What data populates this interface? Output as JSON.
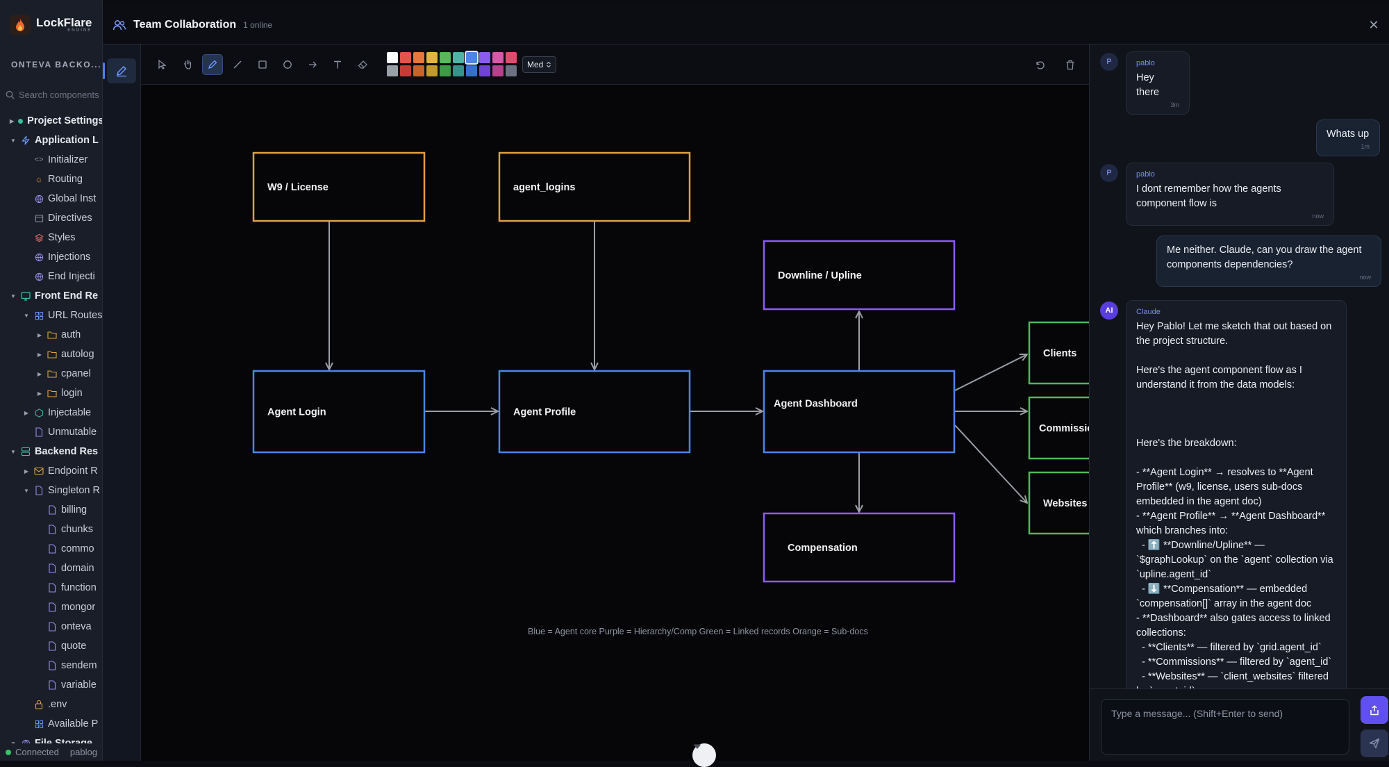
{
  "sidebar": {
    "brand_name": "LockFlare",
    "brand_sub": "ENGINE",
    "project_name": "ONTEVA BACKO...",
    "search_placeholder": "Search components",
    "tree": [
      {
        "label": "Project Settings",
        "arrow": "right",
        "icon": "green-dot-icon",
        "bold": true,
        "indent": 0
      },
      {
        "label": "Application L",
        "arrow": "down",
        "icon": "lightning-icon",
        "bold": true,
        "indent": 0
      },
      {
        "label": "Initializer",
        "arrow": "",
        "icon": "code-icon",
        "bold": false,
        "indent": 1
      },
      {
        "label": "Routing",
        "arrow": "",
        "icon": "sun-icon",
        "bold": false,
        "indent": 1
      },
      {
        "label": "Global Inst",
        "arrow": "",
        "icon": "globe-icon",
        "bold": false,
        "indent": 1
      },
      {
        "label": "Directives",
        "arrow": "",
        "icon": "window-icon",
        "bold": false,
        "indent": 1
      },
      {
        "label": "Styles",
        "arrow": "",
        "icon": "layers-icon",
        "bold": false,
        "indent": 1
      },
      {
        "label": "Injections",
        "arrow": "",
        "icon": "globe-icon",
        "bold": false,
        "indent": 1
      },
      {
        "label": "End Injecti",
        "arrow": "",
        "icon": "globe-icon",
        "bold": false,
        "indent": 1
      },
      {
        "label": "Front End Re",
        "arrow": "down",
        "icon": "monitor-icon",
        "bold": true,
        "indent": 0
      },
      {
        "label": "URL Routes",
        "arrow": "down",
        "icon": "grid-icon",
        "bold": false,
        "indent": 1
      },
      {
        "label": "auth",
        "arrow": "right",
        "icon": "folder-icon",
        "bold": false,
        "indent": 2
      },
      {
        "label": "autolog",
        "arrow": "right",
        "icon": "folder-icon",
        "bold": false,
        "indent": 2
      },
      {
        "label": "cpanel",
        "arrow": "right",
        "icon": "folder-icon",
        "bold": false,
        "indent": 2
      },
      {
        "label": "login",
        "arrow": "right",
        "icon": "folder-icon",
        "bold": false,
        "indent": 2
      },
      {
        "label": "Injectable",
        "arrow": "right",
        "icon": "hexagon-icon",
        "bold": false,
        "indent": 1
      },
      {
        "label": "Unmutable",
        "arrow": "",
        "icon": "file-icon",
        "bold": false,
        "indent": 1
      },
      {
        "label": "Backend Res",
        "arrow": "down",
        "icon": "database-icon",
        "bold": true,
        "indent": 0
      },
      {
        "label": "Endpoint R",
        "arrow": "right",
        "icon": "mail-icon",
        "bold": false,
        "indent": 1
      },
      {
        "label": "Singleton R",
        "arrow": "down",
        "icon": "file-icon",
        "bold": false,
        "indent": 1
      },
      {
        "label": "billing",
        "arrow": "",
        "icon": "file-icon",
        "bold": false,
        "indent": 2
      },
      {
        "label": "chunks",
        "arrow": "",
        "icon": "file-icon",
        "bold": false,
        "indent": 2
      },
      {
        "label": "commo",
        "arrow": "",
        "icon": "file-icon",
        "bold": false,
        "indent": 2
      },
      {
        "label": "domain",
        "arrow": "",
        "icon": "file-icon",
        "bold": false,
        "indent": 2
      },
      {
        "label": "function",
        "arrow": "",
        "icon": "file-icon",
        "bold": false,
        "indent": 2
      },
      {
        "label": "mongor",
        "arrow": "",
        "icon": "file-icon",
        "bold": false,
        "indent": 2
      },
      {
        "label": "onteva",
        "arrow": "",
        "icon": "file-icon",
        "bold": false,
        "indent": 2
      },
      {
        "label": "quote",
        "arrow": "",
        "icon": "file-icon",
        "bold": false,
        "indent": 2
      },
      {
        "label": "sendem",
        "arrow": "",
        "icon": "file-icon",
        "bold": false,
        "indent": 2
      },
      {
        "label": "variable",
        "arrow": "",
        "icon": "file-icon",
        "bold": false,
        "indent": 2
      },
      {
        "label": ".env",
        "arrow": "",
        "icon": "lock-icon",
        "bold": false,
        "indent": 1
      },
      {
        "label": "Available P",
        "arrow": "",
        "icon": "grid-icon",
        "bold": false,
        "indent": 1
      },
      {
        "label": "File Storage",
        "arrow": "down",
        "icon": "globe-icon",
        "bold": true,
        "indent": 0
      }
    ],
    "status_text": "Connected",
    "status_user": "pablog"
  },
  "modal": {
    "title": "Team Collaboration",
    "online": "1 online",
    "size_select": "Med"
  },
  "palette": {
    "top": [
      "#ffffff",
      "#e5534b",
      "#e8773a",
      "#e2b53e",
      "#57b85c",
      "#4fb3a5",
      "#4a86e8",
      "#8a5cf0",
      "#d957a8",
      "#e14c6e"
    ],
    "bottom": [
      "#9aa0a8",
      "#c43c36",
      "#c8642a",
      "#c2992c",
      "#3f9a48",
      "#36928a",
      "#356fd0",
      "#6f43d4",
      "#b8408c",
      "#6b7180"
    ],
    "selected": "#4a86e8"
  },
  "diagram": {
    "colors": {
      "blue": "#4a86e8",
      "purple": "#8a5cf0",
      "green": "#4fb85a",
      "orange": "#e2a03e",
      "edge": "#9a9ea6"
    },
    "nodes": [
      {
        "id": "w9",
        "label": "W9 / License",
        "color": "orange"
      },
      {
        "id": "agent_logins",
        "label": "agent_logins",
        "color": "orange"
      },
      {
        "id": "downline",
        "label": "Downline / Upline",
        "color": "purple"
      },
      {
        "id": "login",
        "label": "Agent Login",
        "color": "blue"
      },
      {
        "id": "profile",
        "label": "Agent Profile",
        "color": "blue"
      },
      {
        "id": "dashboard",
        "label": "Agent Dashboard",
        "color": "blue"
      },
      {
        "id": "compensation",
        "label": "Compensation",
        "color": "purple"
      },
      {
        "id": "clients",
        "label": "Clients",
        "color": "green"
      },
      {
        "id": "commissions",
        "label": "Commissions",
        "color": "green"
      },
      {
        "id": "websites",
        "label": "Websites",
        "color": "green"
      }
    ],
    "legend": "Blue = Agent core   Purple = Hierarchy/Comp   Green = Linked records   Orange = Sub-docs"
  },
  "chat": {
    "messages": [
      {
        "author": "pablo",
        "avatar": "P",
        "mine": false,
        "text": "Hey there",
        "time": "3m"
      },
      {
        "author": "",
        "avatar": "",
        "mine": true,
        "text": "Whats up",
        "time": "1m"
      },
      {
        "author": "pablo",
        "avatar": "P",
        "mine": false,
        "text": "I dont remember how the agents component flow is",
        "time": "now"
      },
      {
        "author": "",
        "avatar": "",
        "mine": true,
        "text": "Me neither. Claude, can you draw the agent components dependencies?",
        "time": "now"
      },
      {
        "author": "Claude",
        "avatar": "AI",
        "mine": false,
        "ai": true,
        "text": "Hey Pablo! Let me sketch that out based on the project structure.\n\nHere's the agent component flow as I understand it from the data models:\n\n\n\nHere's the breakdown:\n\n- **Agent Login** → resolves to **Agent Profile** (w9, license, users sub-docs embedded in the agent doc)\n- **Agent Profile** → **Agent Dashboard** which branches into:\n  - ⬆️ **Downline/Upline** — `$graphLookup` on the `agent` collection via `upline.agent_id`\n  - ⬇️ **Compensation** — embedded `compensation[]` array in the agent doc\n- **Dashboard** also gates access to linked collections:\n  - **Clients** — filtered by `grid.agent_id`\n  - **Commissions** — filtered by `agent_id`\n  - **Websites** — `client_websites` filtered by `agent_id`",
        "time": ""
      }
    ],
    "input_placeholder": "Type a message... (Shift+Enter to send)"
  }
}
